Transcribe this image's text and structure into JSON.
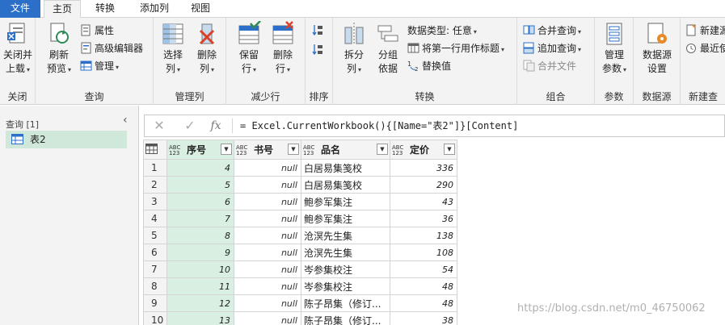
{
  "tabs": [
    {
      "label": "文件"
    },
    {
      "label": "主页"
    },
    {
      "label": "转换"
    },
    {
      "label": "添加列"
    },
    {
      "label": "视图"
    }
  ],
  "ribbon": {
    "close": {
      "label1": "关闭并",
      "label2": "上载",
      "group": "关闭"
    },
    "query": {
      "refresh1": "刷新",
      "refresh2": "预览",
      "properties": "属性",
      "advanced_editor": "高级编辑器",
      "manage": "管理",
      "group": "查询"
    },
    "manage_cols": {
      "select1": "选择",
      "select2": "列",
      "remove1": "删除",
      "remove2": "列",
      "group": "管理列"
    },
    "reduce_rows": {
      "keep1": "保留",
      "keep2": "行",
      "remove1": "删除",
      "remove2": "行",
      "group": "减少行"
    },
    "sort": {
      "group": "排序"
    },
    "transform": {
      "split1": "拆分",
      "split2": "列",
      "groupby1": "分组",
      "groupby2": "依据",
      "datatype": "数据类型: 任意",
      "first_row": "将第一行用作标题",
      "replace": "替换值",
      "group": "转换"
    },
    "combine": {
      "merge": "合并查询",
      "append": "追加查询",
      "combine_files": "合并文件",
      "group": "组合"
    },
    "params": {
      "label1": "管理",
      "label2": "参数",
      "group": "参数"
    },
    "datasource": {
      "label1": "数据源",
      "label2": "设置",
      "group": "数据源"
    },
    "new": {
      "new_src": "新建源",
      "recent": "最近使",
      "group": "新建查"
    }
  },
  "left_pane": {
    "title": "查询 [1]",
    "items": [
      {
        "label": "表2"
      }
    ]
  },
  "formula": "= Excel.CurrentWorkbook(){[Name=\"表2\"]}[Content]",
  "grid": {
    "type_badge_top": "ABC",
    "type_badge_bottom": "123",
    "columns": [
      "序号",
      "书号",
      "品名",
      "定价"
    ],
    "null_text": "null",
    "rows": [
      {
        "n": "1",
        "seq": "4",
        "book": "null",
        "name": "白居易集笺校",
        "price": "336"
      },
      {
        "n": "2",
        "seq": "5",
        "book": "null",
        "name": "白居易集笺校",
        "price": "290"
      },
      {
        "n": "3",
        "seq": "6",
        "book": "null",
        "name": "鲍参军集注",
        "price": "43"
      },
      {
        "n": "4",
        "seq": "7",
        "book": "null",
        "name": "鲍参军集注",
        "price": "36"
      },
      {
        "n": "5",
        "seq": "8",
        "book": "null",
        "name": "沧溟先生集",
        "price": "138"
      },
      {
        "n": "6",
        "seq": "9",
        "book": "null",
        "name": "沧溟先生集",
        "price": "108"
      },
      {
        "n": "7",
        "seq": "10",
        "book": "null",
        "name": "岑参集校注",
        "price": "54"
      },
      {
        "n": "8",
        "seq": "11",
        "book": "null",
        "name": "岑参集校注",
        "price": "48"
      },
      {
        "n": "9",
        "seq": "12",
        "book": "null",
        "name": "陈子昂集（修订...",
        "price": "48"
      },
      {
        "n": "10",
        "seq": "13",
        "book": "null",
        "name": "陈子昂集（修订...",
        "price": "38"
      }
    ]
  },
  "watermark": "https://blog.csdn.net/m0_46750062",
  "colors": {
    "accent": "#2b6fc8",
    "selection": "#d9efe2",
    "ribbon_bg": "#f3f3f3"
  }
}
